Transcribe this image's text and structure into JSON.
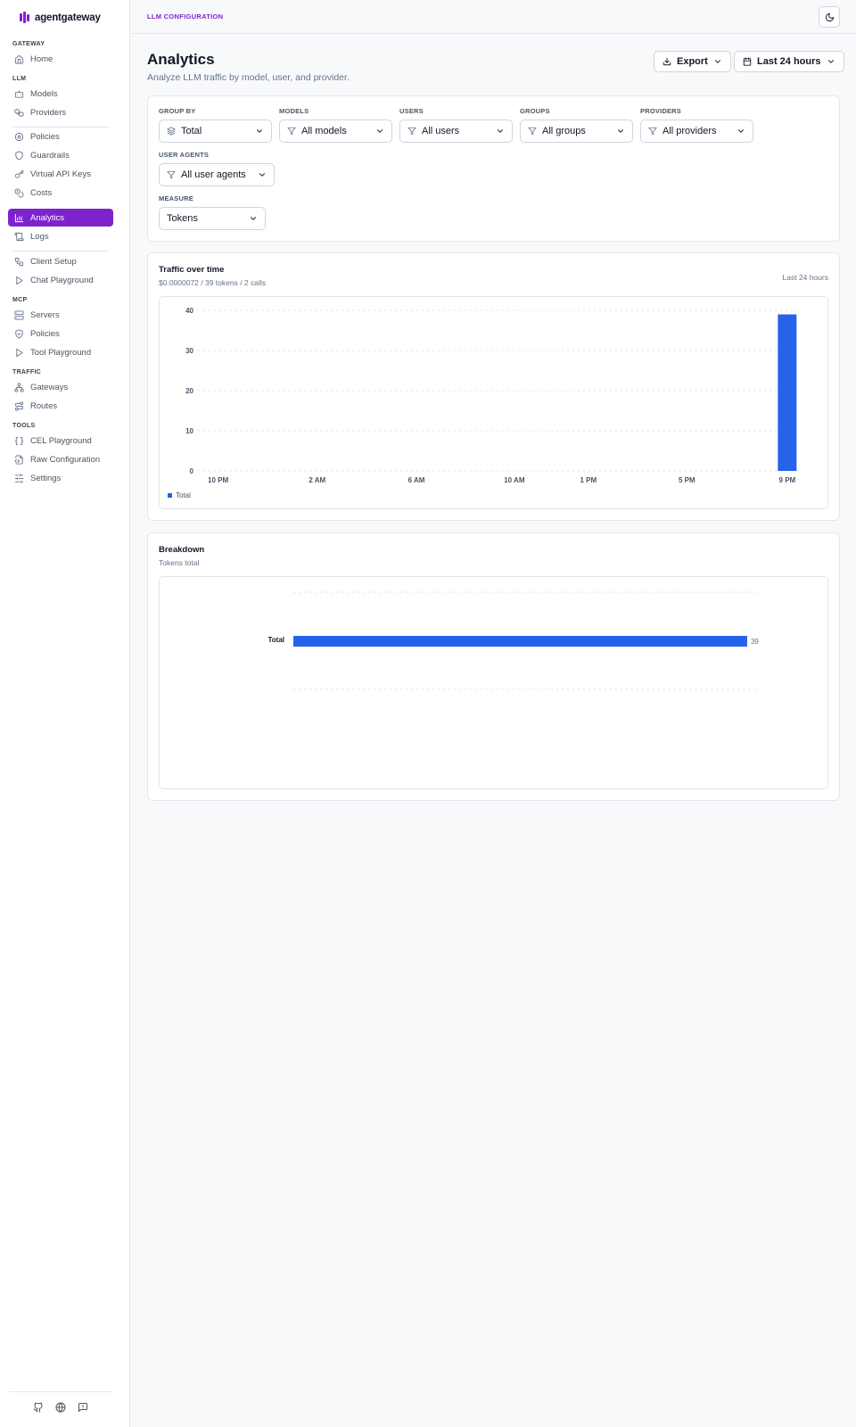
{
  "brand": {
    "name": "agentgateway",
    "color": "#7e22ce"
  },
  "sidebar": {
    "sections": [
      {
        "title": "GATEWAY",
        "items": [
          {
            "label": "Home",
            "icon": "home-icon"
          }
        ]
      },
      {
        "title": "LLM",
        "items": [
          {
            "label": "Models",
            "icon": "bot-icon"
          },
          {
            "label": "Providers",
            "icon": "boxes-icon"
          },
          {
            "label": "Policies",
            "icon": "settings-icon"
          },
          {
            "label": "Guardrails",
            "icon": "shield-icon"
          },
          {
            "label": "Virtual API Keys",
            "icon": "key-icon"
          },
          {
            "label": "Costs",
            "icon": "coins-icon"
          },
          {
            "label": "Analytics",
            "icon": "bar-chart-icon",
            "active": true
          },
          {
            "label": "Logs",
            "icon": "scroll-icon"
          },
          {
            "label": "Client Setup",
            "icon": "workflow-icon"
          },
          {
            "label": "Chat Playground",
            "icon": "play-icon"
          }
        ]
      },
      {
        "title": "MCP",
        "items": [
          {
            "label": "Servers",
            "icon": "server-icon"
          },
          {
            "label": "Policies",
            "icon": "shield-check-icon"
          },
          {
            "label": "Tool Playground",
            "icon": "play-icon"
          }
        ]
      },
      {
        "title": "TRAFFIC",
        "items": [
          {
            "label": "Gateways",
            "icon": "network-icon"
          },
          {
            "label": "Routes",
            "icon": "route-icon"
          }
        ]
      },
      {
        "title": "TOOLS",
        "items": [
          {
            "label": "CEL Playground",
            "icon": "braces-icon"
          },
          {
            "label": "Raw Configuration",
            "icon": "file-code-icon"
          },
          {
            "label": "Settings",
            "icon": "sliders-icon"
          }
        ]
      }
    ],
    "footer_icons": [
      "github-icon",
      "globe-icon",
      "feedback-icon"
    ]
  },
  "topbar": {
    "title": "LLM CONFIGURATION",
    "theme_icon": "moon-icon"
  },
  "header": {
    "title": "Analytics",
    "subtitle": "Analyze LLM traffic by model, user, and provider.",
    "export_label": "Export",
    "range_label": "Last 24 hours"
  },
  "filters": {
    "group_by": {
      "label": "GROUP BY",
      "value": "Total"
    },
    "models": {
      "label": "MODELS",
      "value": "All models"
    },
    "users": {
      "label": "USERS",
      "value": "All users"
    },
    "groups": {
      "label": "GROUPS",
      "value": "All groups"
    },
    "providers": {
      "label": "PROVIDERS",
      "value": "All providers"
    },
    "user_agents": {
      "label": "USER AGENTS",
      "value": "All user agents"
    },
    "measure": {
      "label": "MEASURE",
      "value": "Tokens"
    }
  },
  "traffic": {
    "title": "Traffic over time",
    "subtitle": "$0.0000072 / 39 tokens / 2 calls",
    "range": "Last 24 hours"
  },
  "breakdown": {
    "title": "Breakdown",
    "subtitle": "Tokens total"
  },
  "chart_data": [
    {
      "type": "bar",
      "x_ticks": [
        "10 PM",
        "2 AM",
        "6 AM",
        "10 AM",
        "1 PM",
        "5 PM",
        "9 PM"
      ],
      "y_ticks": [
        0,
        10,
        20,
        30,
        40
      ],
      "ylim": [
        0,
        40
      ],
      "grid": true,
      "legend_position": "bottom-left",
      "series": [
        {
          "name": "Total",
          "color": "#2563eb",
          "points": [
            {
              "x": "9 PM",
              "y": 39
            }
          ]
        }
      ]
    },
    {
      "type": "bar",
      "orientation": "horizontal",
      "categories": [
        "Total"
      ],
      "values": [
        39
      ],
      "data_labels": [
        "39"
      ],
      "xlim": [
        0,
        40
      ],
      "color": "#2563eb"
    }
  ]
}
